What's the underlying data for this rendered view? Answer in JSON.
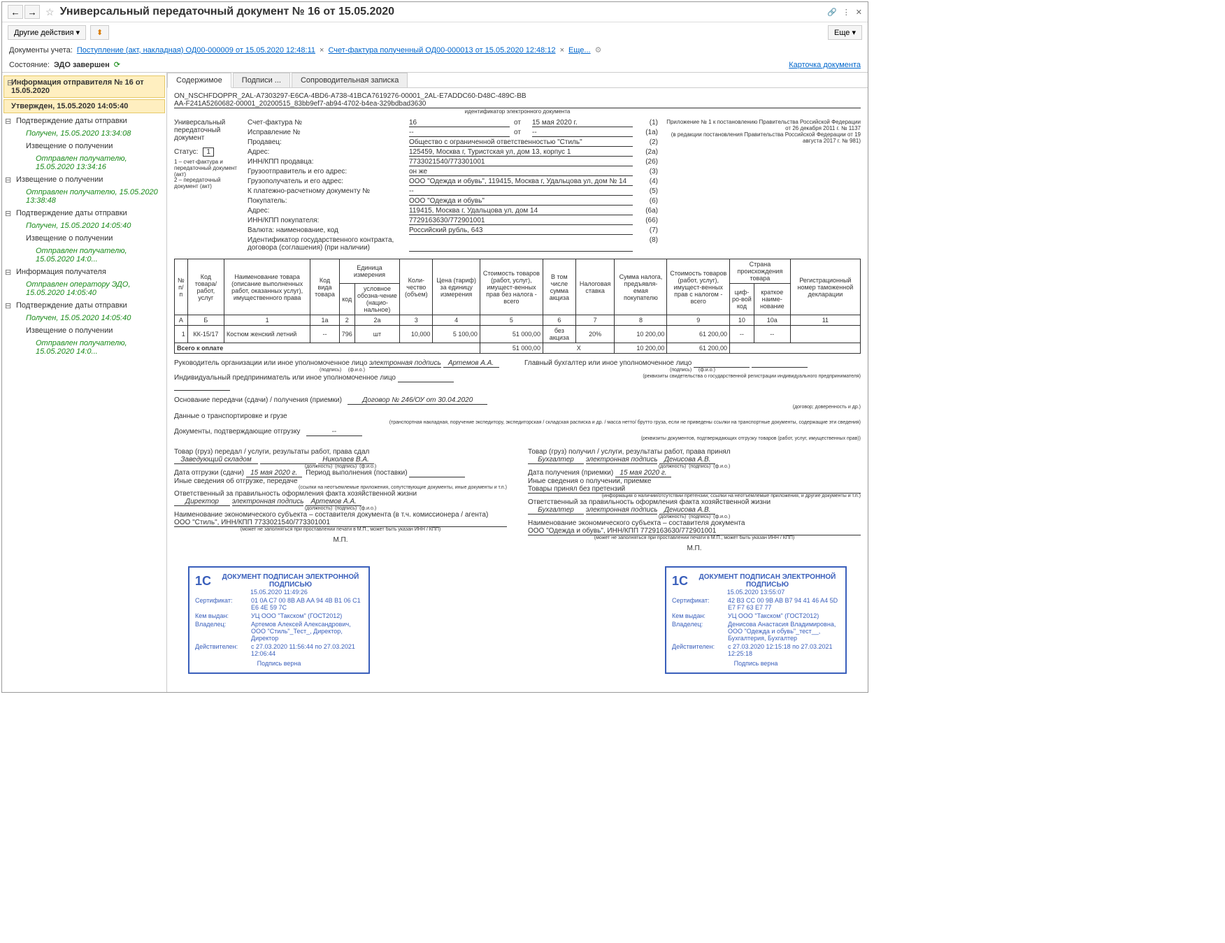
{
  "title": "Универсальный передаточный документ № 16 от 15.05.2020",
  "toolbar": {
    "other_actions": "Другие действия",
    "more": "Еще"
  },
  "doclinks": {
    "label": "Документы учета:",
    "link1": "Поступление (акт, накладная) ОД00-000009 от 15.05.2020 12:48:11",
    "link2": "Счет-фактура полученный ОД00-000013 от 15.05.2020 12:48:12",
    "more": "Еще..."
  },
  "status": {
    "label": "Состояние:",
    "value": "ЭДО завершен",
    "card_link": "Карточка документа"
  },
  "sidebar": {
    "root": "Информация отправителя № 16 от 15.05.2020",
    "root_sub": "Утвержден, 15.05.2020 14:05:40",
    "items": [
      {
        "t": "Подтверждение даты отправки",
        "lvl": 1,
        "toggle": true
      },
      {
        "t": "Получен, 15.05.2020 13:34:08",
        "lvl": 2,
        "green": true
      },
      {
        "t": "Извещение о получении",
        "lvl": 2
      },
      {
        "t": "Отправлен получателю, 15.05.2020 13:34:16",
        "lvl": 3,
        "green": true
      },
      {
        "t": "Извещение о получении",
        "lvl": 1,
        "toggle": true
      },
      {
        "t": "Отправлен получателю, 15.05.2020 13:38:48",
        "lvl": 2,
        "green": true
      },
      {
        "t": "Подтверждение даты отправки",
        "lvl": 1,
        "toggle": true
      },
      {
        "t": "Получен, 15.05.2020 14:05:40",
        "lvl": 2,
        "green": true
      },
      {
        "t": "Извещение о получении",
        "lvl": 2
      },
      {
        "t": "Отправлен получателю, 15.05.2020 14:0...",
        "lvl": 3,
        "green": true
      },
      {
        "t": "Информация получателя",
        "lvl": 1,
        "toggle": true
      },
      {
        "t": "Отправлен оператору ЭДО, 15.05.2020 14:05:40",
        "lvl": 2,
        "green": true
      },
      {
        "t": "Подтверждение даты отправки",
        "lvl": 1,
        "toggle": true
      },
      {
        "t": "Получен, 15.05.2020 14:05:40",
        "lvl": 2,
        "green": true
      },
      {
        "t": "Извещение о получении",
        "lvl": 2
      },
      {
        "t": "Отправлен получателю, 15.05.2020 14:0...",
        "lvl": 3,
        "green": true
      }
    ]
  },
  "tabs": {
    "content": "Содержимое",
    "signatures": "Подписи ...",
    "note": "Сопроводительная записка"
  },
  "doc": {
    "id_line1": "ON_NSCHFDOPPR_2AL-A7303297-E6CA-4BD6-A738-41BCA7619276-00001_2AL-E7ADDC60-D48C-489C-BB",
    "id_line2": "AA-F241A5260682-00001_20200515_83bb9ef7-ab94-4702-b4ea-329bdbad3630",
    "id_caption": "идентификатор электронного документа",
    "left_doc_type": "Универсальный передаточный документ",
    "status_label": "Статус:",
    "status_val": "1",
    "status_note": "1 – счет-фактура и передаточный документ (акт)\n2 – передаточный документ (акт)",
    "appendix": "Приложение № 1 к постановлению Правительства Российской Федерации от 26 декабря 2011 г. № 1137\n(в редакции постановления Правительства Российской Федерации от 19 августа 2017 г. № 981)",
    "fields": [
      {
        "l": "Счет-фактура №",
        "v": "16",
        "l2": "от",
        "v2": "15 мая 2020 г.",
        "n": "(1)"
      },
      {
        "l": "Исправление №",
        "v": "--",
        "l2": "от",
        "v2": "--",
        "n": "(1а)"
      },
      {
        "l": "Продавец:",
        "v": "Общество с ограниченной ответственностью \"Стиль\"",
        "n": "(2)"
      },
      {
        "l": "Адрес:",
        "v": "125459, Москва г, Туристская ул, дом 13, корпус 1",
        "n": "(2а)"
      },
      {
        "l": "ИНН/КПП продавца:",
        "v": "7733021540/773301001",
        "n": "(26)"
      },
      {
        "l": "Грузоотправитель и его адрес:",
        "v": "он же",
        "n": "(3)"
      },
      {
        "l": "Грузополучатель и его адрес:",
        "v": "ООО \"Одежда и обувь\", 119415, Москва г, Удальцова ул, дом № 14",
        "n": "(4)"
      },
      {
        "l": "К платежно-расчетному документу №",
        "v": "--",
        "n": "(5)"
      },
      {
        "l": "Покупатель:",
        "v": "ООО \"Одежда и обувь\"",
        "n": "(6)"
      },
      {
        "l": "Адрес:",
        "v": "119415, Москва г, Удальцова ул, дом 14",
        "n": "(6а)"
      },
      {
        "l": "ИНН/КПП покупателя:",
        "v": "7729163630/772901001",
        "n": "(66)"
      },
      {
        "l": "Валюта: наименование, код",
        "v": "Российский рубль, 643",
        "n": "(7)"
      },
      {
        "l": "Идентификатор государственного контракта, договора (соглашения) (при наличии)",
        "v": "",
        "n": "(8)"
      }
    ],
    "table": {
      "headers": {
        "np": "№ п/п",
        "code": "Код товара/ работ, услуг",
        "name": "Наименование товара (описание выполненных работ, оказанных услуг), имущественного права",
        "kind": "Код вида товара",
        "unit": "Единица измерения",
        "unit_code": "код",
        "unit_name": "условное обозна-чение (нацио-нальное)",
        "qty": "Коли-чество (объем)",
        "price": "Цена (тариф) за единицу измерения",
        "cost_no_tax": "Стоимость товаров (работ, услуг), имущест-венных прав без налога - всего",
        "excise": "В том числе сумма акциза",
        "rate": "Налоговая ставка",
        "tax_sum": "Сумма налога, предъявля-емая покупателю",
        "cost_tax": "Стоимость товаров (работ, услуг), имущест-венных прав с налогом - всего",
        "country": "Страна происхождения товара",
        "country_code": "циф-ро-вой код",
        "country_name": "краткое наиме-нование",
        "decl": "Регистрационный номер таможенной декларации"
      },
      "colnums": [
        "А",
        "Б",
        "1",
        "1а",
        "2",
        "2а",
        "3",
        "4",
        "5",
        "6",
        "7",
        "8",
        "9",
        "10",
        "10а",
        "11"
      ],
      "row": {
        "n": "1",
        "code": "КК-15/17",
        "name": "Костюм женский летний",
        "kind": "--",
        "ucode": "796",
        "uname": "шт",
        "qty": "10,000",
        "price": "5 100,00",
        "cost": "51 000,00",
        "excise": "без акциза",
        "rate": "20%",
        "tax": "10 200,00",
        "total": "61 200,00",
        "ccode": "--",
        "cname": "--",
        "decl": ""
      },
      "total_label": "Всего к оплате",
      "totals": {
        "cost": "51 000,00",
        "x": "X",
        "tax": "10 200,00",
        "total": "61 200,00"
      }
    },
    "signers": {
      "head_lbl": "Руководитель организации или иное уполномоченное лицо",
      "head_sig": "электронная подпись",
      "head_name": "Артемов А.А.",
      "acc_lbl": "Главный бухгалтер или иное уполномоченное лицо",
      "ip_lbl": "Индивидуальный предприниматель или иное уполномоченное лицо",
      "sig_cap": "(подпись)",
      "fio_cap": "(ф.и.о.)",
      "req_cap": "(реквизиты свидетельства о государственной регистрации индивидуального предпринимателя)"
    },
    "basis": {
      "l": "Основание передачи (сдачи) / получения (приемки)",
      "v": "Договор № 246/ОУ от 30.04.2020",
      "cap": "(договор; доверенность и др.)"
    },
    "transport": {
      "l": "Данные о транспортировке и грузе",
      "cap": "(транспортная накладная, поручение экспедитору, экспедиторская / складская расписка и др. / масса нетто/ брутто груза, если не приведены ссылки на транспортные документы, содержащие эти сведения)"
    },
    "ship_docs": {
      "l": "Документы, подтверждающие отгрузку",
      "v": "--",
      "cap": "(реквизиты документов, подтверждающих отгрузку товаров (работ, услуг, имущественных прав))"
    },
    "left": {
      "title": "Товар (груз) передал / услуги, результаты работ, права сдал",
      "pos": "Заведующий складом",
      "name": "Николаев В.А.",
      "date_l": "Дата отгрузки (сдачи)",
      "date_v": "15 мая 2020 г.",
      "period": "Период выполнения (поставки)",
      "other": "Иные сведения об отгрузке, передаче",
      "other_cap": "(ссылки на неотъемлемые приложения, сопутствующие документы, иные документы и т.п.)",
      "resp": "Ответственный за правильность оформления факта хозяйственной жизни",
      "resp_pos": "Директор",
      "resp_sig": "электронная подпись",
      "resp_name": "Артемов А.А.",
      "org_l": "Наименование экономического субъекта – составителя документа (в т.ч. комиссионера / агента)",
      "org_v": "ООО \"Стиль\", ИНН/КПП 7733021540/773301001",
      "org_cap": "(может не заполняться при проставлении печати в М.П., может быть указан ИНН / КПП)",
      "mp": "М.П."
    },
    "right": {
      "title": "Товар (груз) получил / услуги, результаты работ, права принял",
      "pos": "Бухгалтер",
      "sig": "электронная подпись",
      "name": "Денисова А.В.",
      "date_l": "Дата получения (приемки)",
      "date_v": "15 мая 2020 г.",
      "other": "Иные сведения о получении, приемке",
      "claims": "Товары принял без претензий",
      "claims_cap": "(информация о наличии/отсутствии претензии; ссылки на неотъемлемые приложения, и другие документы и т.п.)",
      "resp": "Ответственный за правильность оформления факта хозяйственной жизни",
      "resp_pos": "Бухгалтер",
      "resp_sig": "электронная подпись",
      "resp_name": "Денисова А.В.",
      "org_l": "Наименование экономического субъекта – составителя документа",
      "org_v": "ООО \"Одежда и обувь\", ИНН/КПП 7729163630/772901001",
      "org_cap": "(может не заполняться при проставлении печати в М.П., может быть указан ИНН / КПП)",
      "mp": "М.П."
    },
    "pos_cap": "(должность)"
  },
  "stamps": {
    "title": "ДОКУМЕНТ ПОДПИСАН ЭЛЕКТРОННОЙ ПОДПИСЬЮ",
    "cert_l": "Сертификат:",
    "issuer_l": "Кем выдан:",
    "owner_l": "Владелец:",
    "valid_l": "Действителен:",
    "footer": "Подпись верна",
    "left": {
      "date": "15.05.2020 11:49:26",
      "cert": "01 0A C7 00 8B AB AA 94 4B B1 06 C1 E6 4E 59 7C",
      "issuer": "УЦ ООО \"Такском\" (ГОСТ2012)",
      "owner": "Артемов Алексей Александрович, ООО \"Стиль\"_Тест_, Директор, Директор",
      "valid": "с 27.03.2020 11:56:44 по 27.03.2021 12:06:44"
    },
    "right": {
      "date": "15.05.2020 13:55:07",
      "cert": "42 B3 CC 00 9B AB B7 94 41 46 A4 5D E7 F7 63 E7 77",
      "issuer": "УЦ ООО \"Такском\" (ГОСТ2012)",
      "owner": "Денисова Анастасия Владимировна, ООО \"Одежда и обувь\"_тест__, Бухгалтерия, Бухгалтер",
      "valid": "с 27.03.2020 12:15:18 по 27.03.2021 12:25:18"
    }
  }
}
